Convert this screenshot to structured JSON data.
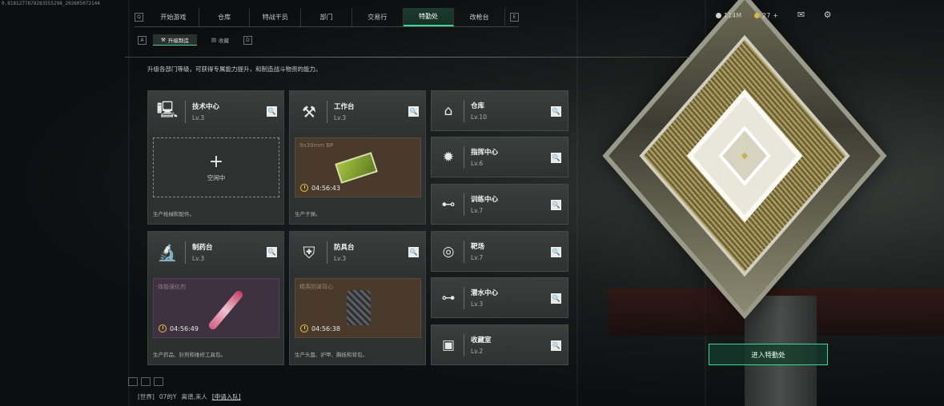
{
  "watermark": "0.8181277878283555298_202605072144",
  "nav": {
    "left_key": "Q",
    "right_key": "E",
    "tabs": [
      "开始游戏",
      "仓库",
      "特战干员",
      "部门",
      "交易行",
      "特勤处",
      "改枪台"
    ],
    "active_tab": "特勤处"
  },
  "resources": {
    "silver": "114M",
    "gold": "27",
    "gold_plus": "+"
  },
  "subnav": {
    "left_key": "A",
    "right_key": "D",
    "tabs": [
      {
        "label": "升级制造",
        "active": true
      },
      {
        "label": "收藏",
        "active": false
      }
    ]
  },
  "description": "升级各部门等级，可获得专属能力提升，和制造战斗物资的能力。",
  "departments_large": [
    {
      "name": "技术中心",
      "level": "Lv.3",
      "icon": "monitor-icon",
      "slot": {
        "type": "empty",
        "label": "空闲中"
      },
      "footer": "生产枪械和配件。"
    },
    {
      "name": "工作台",
      "level": "Lv.3",
      "icon": "tools-icon",
      "slot": {
        "type": "busy",
        "item": "9x39mm BP",
        "timer": "04:56:43",
        "art": "ammo-box"
      },
      "footer": "生产子弹。"
    },
    {
      "name": "制药台",
      "level": "Lv.3",
      "icon": "microscope-icon",
      "slot": {
        "type": "busy",
        "item": "体能强化剂",
        "timer": "04:56:49",
        "art": "syringe"
      },
      "footer": "生产药品、针剂和维修工具包。"
    },
    {
      "name": "防具台",
      "level": "Lv.3",
      "icon": "armor-icon",
      "slot": {
        "type": "busy",
        "item": "精英防弹背心",
        "timer": "04:56:38",
        "art": "vest"
      },
      "footer": "生产头盔、护甲、胸挂和背包。"
    }
  ],
  "departments_small": [
    {
      "name": "仓库",
      "level": "Lv.10",
      "icon": "vault-icon"
    },
    {
      "name": "指挥中心",
      "level": "Lv.6",
      "icon": "command-icon"
    },
    {
      "name": "训练中心",
      "level": "Lv.7",
      "icon": "dumbbell-icon"
    },
    {
      "name": "靶场",
      "level": "Lv.7",
      "icon": "target-icon"
    },
    {
      "name": "潜水中心",
      "level": "Lv.3",
      "icon": "diving-icon"
    },
    {
      "name": "收藏室",
      "level": "Lv.2",
      "icon": "collection-icon"
    }
  ],
  "enter_button": "进入特勤处",
  "chat": {
    "channel": "[世界]",
    "user": "07的Y",
    "message": "离谱,来人",
    "invite": "[申请入队]"
  },
  "colors": {
    "accent": "#45d39a",
    "card_bg": "#2e3331",
    "brown_slot": "#4a3a2c",
    "purple_slot": "#3e3140"
  }
}
